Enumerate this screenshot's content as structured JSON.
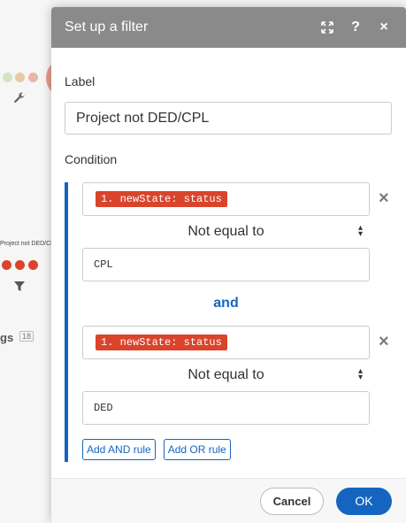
{
  "colors": {
    "accent": "#1565c0",
    "pill": "#d9442b",
    "header": "#8a8a8a"
  },
  "background": {
    "module_label": "Project not DED/CPL",
    "sidebar_text": "gs",
    "sidebar_badge": "18"
  },
  "dialog": {
    "title": "Set up a filter",
    "header_icons": [
      "expand-icon",
      "help-icon",
      "close-icon"
    ],
    "help_glyph": "?",
    "close_glyph": "×",
    "label_field_label": "Label",
    "label_value": "Project not DED/CPL",
    "condition_label": "Condition",
    "rules": [
      {
        "operand": "1. newState: status",
        "operator": "Not equal to",
        "value": "CPL"
      },
      {
        "operand": "1. newState: status",
        "operator": "Not equal to",
        "value": "DED"
      }
    ],
    "conjunction": "and",
    "add_and_rule": "Add AND rule",
    "add_or_rule": "Add OR rule",
    "cancel": "Cancel",
    "ok": "OK"
  }
}
